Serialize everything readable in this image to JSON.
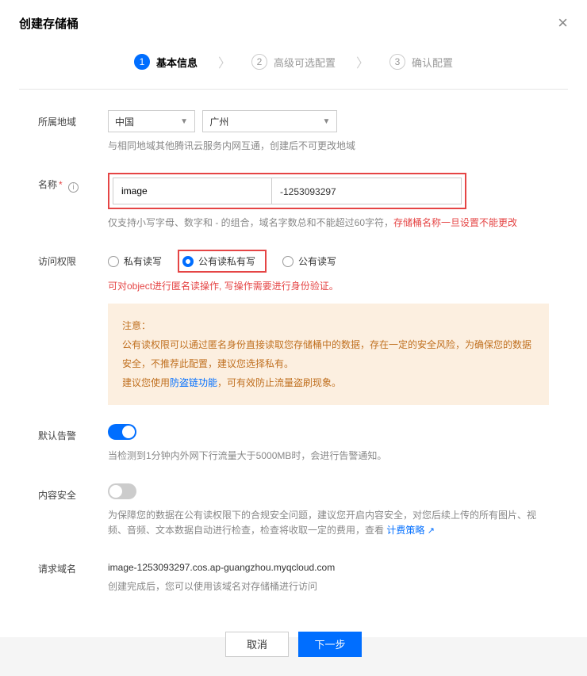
{
  "modal": {
    "title": "创建存储桶",
    "close": "×"
  },
  "steps": {
    "s1": {
      "num": "1",
      "label": "基本信息"
    },
    "s2": {
      "num": "2",
      "label": "高级可选配置"
    },
    "s3": {
      "num": "3",
      "label": "确认配置"
    },
    "sep": "〉"
  },
  "region": {
    "label": "所属地域",
    "country": "中国",
    "city": "广州",
    "hint": "与相同地域其他腾讯云服务内网互通，创建后不可更改地域"
  },
  "name": {
    "label": "名称",
    "placeholder": "",
    "value": "image",
    "suffix": "-1253093297",
    "hint_pre": "仅支持小写字母、数字和 - 的组合，域名字数总和不能超过60字符，",
    "hint_warn": "存储桶名称一旦设置不能更改"
  },
  "perm": {
    "label": "访问权限",
    "opt1": "私有读写",
    "opt2": "公有读私有写",
    "opt3": "公有读写",
    "warn": "可对object进行匿名读操作, 写操作需要进行身份验证。",
    "notice_title": "注意：",
    "notice_l1": "公有读权限可以通过匿名身份直接读取您存储桶中的数据，存在一定的安全风险，为确保您的数据安全，不推荐此配置，建议您选择私有。",
    "notice_l2a": "建议您使用",
    "notice_link": "防盗链功能",
    "notice_l2b": "，可有效防止流量盗刷现象。"
  },
  "alarm": {
    "label": "默认告警",
    "hint": "当检测到1分钟内外网下行流量大于5000MB时，会进行告警通知。"
  },
  "security": {
    "label": "内容安全",
    "hint_a": "为保障您的数据在公有读权限下的合规安全问题，建议您开启内容安全，对您后续上传的所有图片、视频、音频、文本数据自动进行检查，检查将收取一定的费用，查看 ",
    "hint_link": "计费策略"
  },
  "domain": {
    "label": "请求域名",
    "value": "image-1253093297.cos.ap-guangzhou.myqcloud.com",
    "hint": "创建完成后，您可以使用该域名对存储桶进行访问"
  },
  "footer": {
    "cancel": "取消",
    "next": "下一步"
  }
}
